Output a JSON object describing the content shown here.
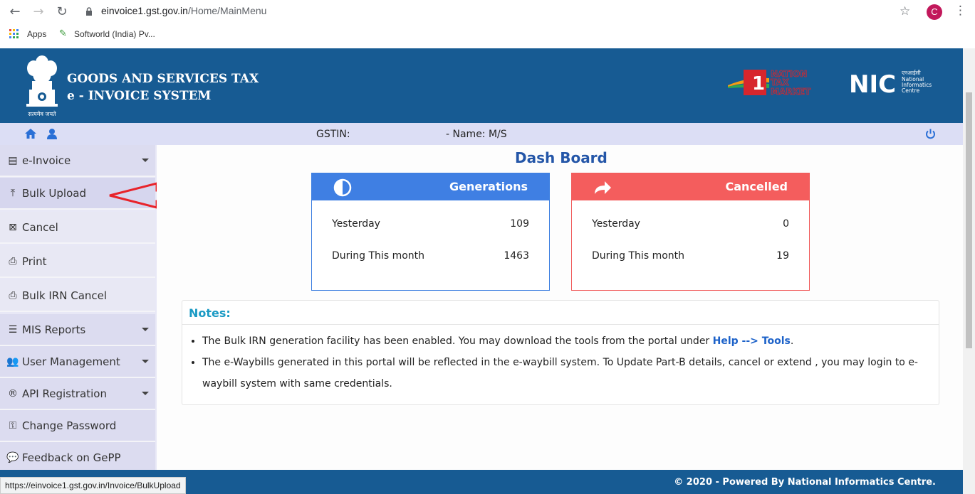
{
  "browser": {
    "url_domain": "einvoice1.gst.gov.in",
    "url_path": "/Home/MainMenu",
    "avatar_letter": "C",
    "bookmarks": [
      {
        "label": "Apps",
        "icon": "apps-grid-icon"
      },
      {
        "label": "Softworld (India) Pv...",
        "icon": "bookmark-icon"
      }
    ],
    "status_url": "https://einvoice1.gst.gov.in/Invoice/BulkUpload"
  },
  "header": {
    "title_line1": "GOODS AND SERVICES TAX",
    "title_line2": "e - INVOICE SYSTEM",
    "emblem_caption": "सत्यमेव जयते"
  },
  "strip": {
    "gstin_label": "GSTIN:",
    "name_label": "- Name: M/S"
  },
  "sidebar": {
    "items": [
      {
        "label": "e-Invoice",
        "icon": "document-icon",
        "expandable": true
      },
      {
        "label": "Bulk Upload",
        "icon": "upload-icon"
      },
      {
        "label": "Cancel",
        "icon": "close-box-icon"
      },
      {
        "label": "Print",
        "icon": "print-icon"
      },
      {
        "label": "Bulk IRN Cancel",
        "icon": "print-icon"
      },
      {
        "label": "MIS Reports",
        "icon": "list-icon",
        "expandable": true
      },
      {
        "label": "User Management",
        "icon": "users-icon",
        "expandable": true
      },
      {
        "label": "API Registration",
        "icon": "registered-icon",
        "expandable": true
      },
      {
        "label": "Change Password",
        "icon": "key-icon"
      },
      {
        "label": "Feedback on GePP",
        "icon": "comments-icon"
      }
    ]
  },
  "dashboard": {
    "title": "Dash Board",
    "generations": {
      "label": "Generations",
      "yesterday_label": "Yesterday",
      "yesterday_value": "109",
      "month_label": "During This month",
      "month_value": "1463",
      "color": "#3f7fe3"
    },
    "cancelled": {
      "label": "Cancelled",
      "yesterday_label": "Yesterday",
      "yesterday_value": "0",
      "month_label": "During This month",
      "month_value": "19",
      "color": "#f45d5d"
    }
  },
  "notes": {
    "title": "Notes:",
    "note1_text": "The Bulk IRN generation facility has been enabled. You may download the tools from the portal under ",
    "note1_link": "Help --> Tools",
    "note1_end": ".",
    "note2_text": "The e-Waybills generated in this portal will be reflected in the e-waybill system. To Update Part-B details, cancel or extend , you may login to e-waybill system with same credentials."
  },
  "footer": {
    "text": "© 2020 - Powered By National Informatics Centre."
  }
}
